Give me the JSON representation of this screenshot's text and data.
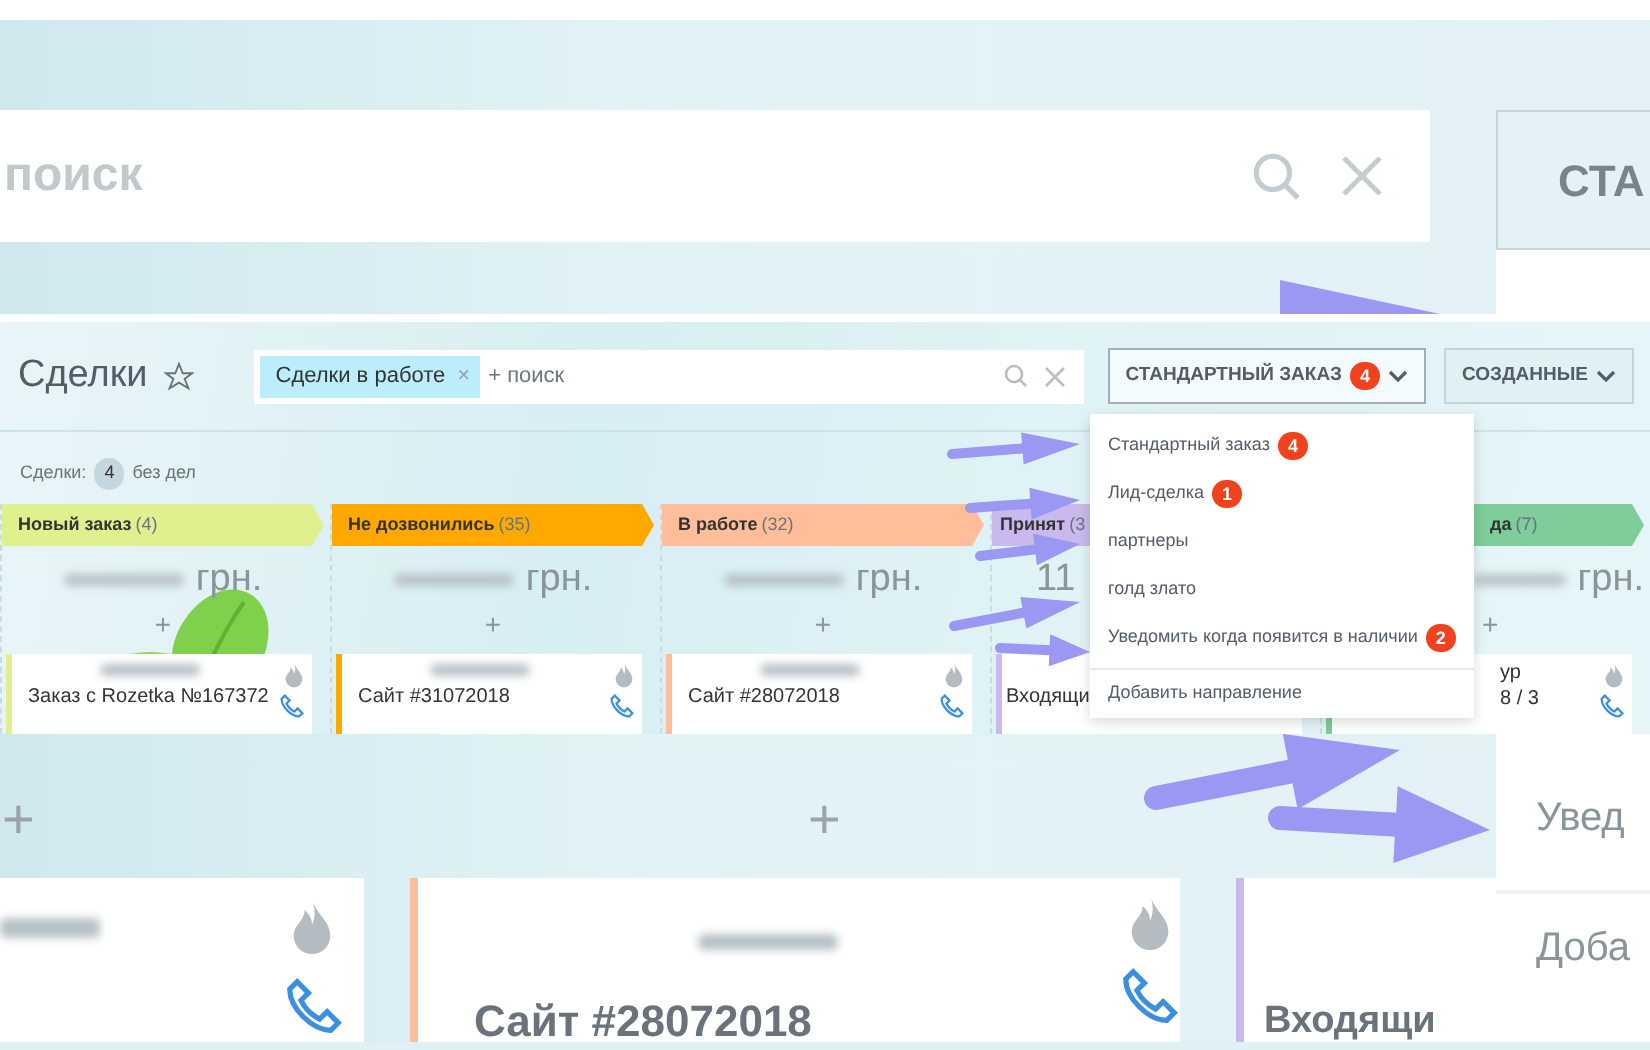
{
  "top_zoom": {
    "search_placeholder": "поиск",
    "button": "СТА"
  },
  "header": {
    "title": "Сделки",
    "filter_chip": "Сделки в работе",
    "chip_remove": "×",
    "search_placeholder": "+ поиск",
    "buttons": [
      {
        "label": "СТАНДАРТНЫЙ ЗАКАЗ",
        "badge": "4",
        "expanded": true
      },
      {
        "label": "СОЗДАННЫЕ",
        "expanded": false
      }
    ]
  },
  "summary": {
    "label": "Сделки:",
    "count": "4",
    "suffix": "без дел"
  },
  "columns": [
    {
      "title": "Новый заказ",
      "count": "(4)",
      "color": "#e1f08f",
      "amount": "грн.",
      "add": "+",
      "cards": [
        {
          "title": "Заказ с Rozetka №167372",
          "actions": true
        }
      ]
    },
    {
      "title": "Не дозвонились",
      "count": "(35)",
      "color": "#ffa900",
      "amount": "грн.",
      "add": "+",
      "cards": [
        {
          "title": "Сайт #31072018",
          "actions": true
        }
      ]
    },
    {
      "title": "В работе",
      "count": "(32)",
      "color": "#ffbd9a",
      "amount": "грн.",
      "add": "+",
      "cards": [
        {
          "title": "Сайт #28072018",
          "actions": true
        }
      ]
    },
    {
      "title": "Принят",
      "count": "(3",
      "color": "#c9b9ec",
      "amount": "11",
      "cards": [
        {
          "title": "Входящи",
          "actions": false
        }
      ]
    },
    {
      "title": "да",
      "count": "(7)",
      "color": "#7fcd9b",
      "amount": "грн.",
      "add": "+",
      "cards": [
        {
          "title": "ур",
          "subtitle": "8 / 3",
          "actions": true
        }
      ]
    }
  ],
  "menu": {
    "items": [
      {
        "label": "Стандартный заказ",
        "badge": "4"
      },
      {
        "label": "Лид-сделка",
        "badge": "1"
      },
      {
        "label": "партнеры"
      },
      {
        "label": "голд злато"
      },
      {
        "label": "Уведомить когда появится в наличии",
        "badge": "2"
      }
    ],
    "footer": "Добавить направление"
  },
  "bottom_zoom": {
    "add_buttons": [
      "+",
      "+"
    ],
    "card_title": "Сайт #28072018",
    "card_partial": "Входящи",
    "menu_items": [
      "Увед",
      "Доба"
    ]
  }
}
